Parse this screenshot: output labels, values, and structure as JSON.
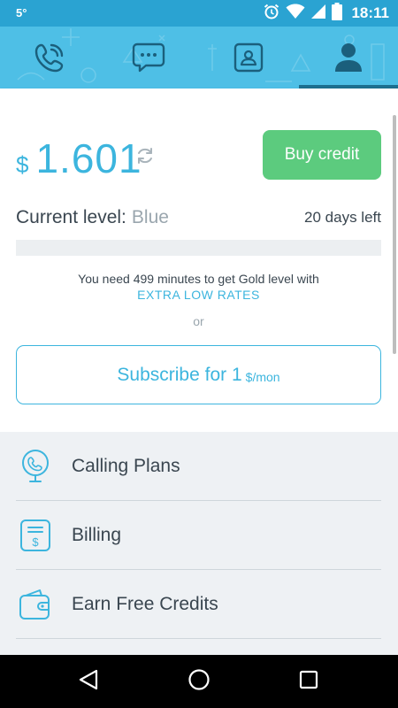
{
  "status_bar": {
    "notification": "5°",
    "time": "18:11"
  },
  "tabs": [
    {
      "name": "calls",
      "icon": "phone-icon",
      "active": false
    },
    {
      "name": "messages",
      "icon": "chat-bubble-icon",
      "active": false
    },
    {
      "name": "contacts",
      "icon": "contact-card-icon",
      "active": false
    },
    {
      "name": "account",
      "icon": "person-icon",
      "active": true
    }
  ],
  "balance": {
    "currency": "$",
    "amount": "1.601",
    "buy_label": "Buy credit"
  },
  "level": {
    "label": "Current level:",
    "value": "Blue",
    "days_left": "20 days left",
    "progress": 0
  },
  "upsell": {
    "message": "You need 499 minutes to get Gold level with",
    "highlight": "EXTRA LOW RATES",
    "or": "or",
    "subscribe_label": "Subscribe for 1",
    "subscribe_unit": "$/mon"
  },
  "menu": {
    "items": [
      {
        "label": "Calling Plans",
        "icon": "globe-phone-icon"
      },
      {
        "label": "Billing",
        "icon": "receipt-dollar-icon"
      },
      {
        "label": "Earn Free Credits",
        "icon": "wallet-icon"
      }
    ]
  },
  "colors": {
    "primary": "#3cb5de",
    "header": "#4ebfe6",
    "status_bar": "#2aa3d2",
    "buy_button": "#5ccb7e",
    "menu_bg": "#eef1f4"
  }
}
